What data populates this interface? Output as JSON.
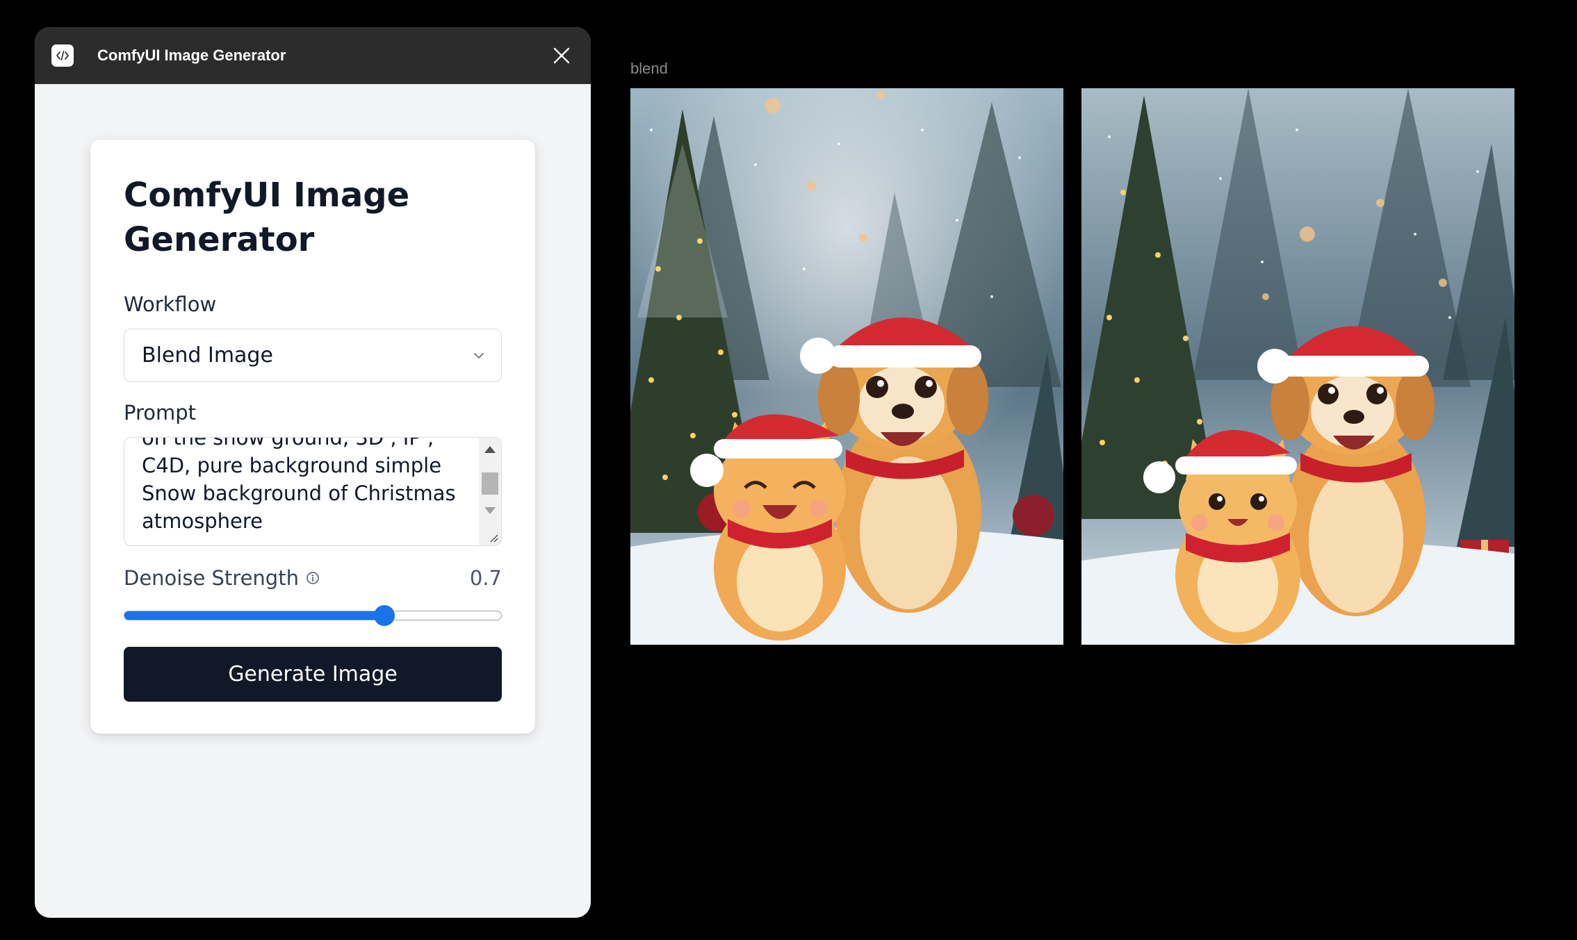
{
  "window": {
    "title": "ComfyUI Image Generator",
    "icon": "code-icon",
    "close_icon": "close-icon"
  },
  "form": {
    "title": "ComfyUI Image Generator",
    "workflow_label": "Workflow",
    "workflow_value": "Blend Image",
    "prompt_label": "Prompt",
    "prompt_text": "on the snow ground, 3D , IP ,\nC4D, pure background simple\nSnow background of Christmas\natmosphere",
    "denoise_label": "Denoise Strength",
    "denoise_value": "0.7",
    "denoise_fraction": 0.69,
    "generate_label": "Generate Image"
  },
  "canvas": {
    "frame_label": "blend",
    "images": [
      {
        "name": "blend-result-cat-dog-christmas-1"
      },
      {
        "name": "blend-result-cat-dog-christmas-2"
      }
    ]
  },
  "colors": {
    "accent": "#1a73e8",
    "button_bg": "#111827",
    "titlebar_bg": "#2c2c2c"
  }
}
